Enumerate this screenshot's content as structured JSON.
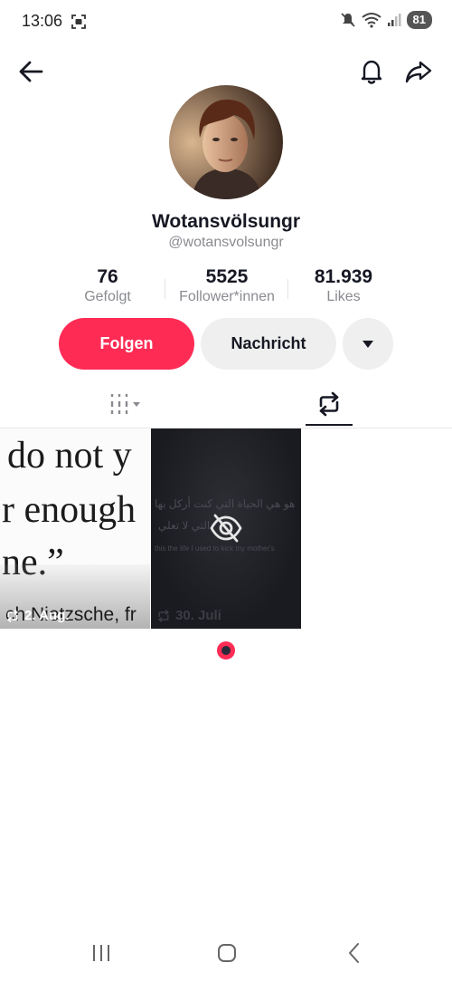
{
  "status_bar": {
    "time": "13:06",
    "battery": "81",
    "icons": [
      "screenshot-icon",
      "mute-icon",
      "wifi-icon",
      "signal-icon",
      "battery-icon"
    ]
  },
  "nav": {
    "icons": [
      "back-arrow-icon",
      "bell-icon",
      "share-icon"
    ]
  },
  "profile": {
    "name": "Wotansvölsungr",
    "handle": "@wotansvolsungr",
    "stats": [
      {
        "value": "76",
        "label": "Gefolgt"
      },
      {
        "value": "5525",
        "label": "Follower*innen"
      },
      {
        "value": "81.939",
        "label": "Likes"
      }
    ]
  },
  "actions": {
    "follow": "Folgen",
    "message": "Nachricht",
    "more_icon": "caret-down-icon"
  },
  "tabs": {
    "items": [
      "videos-grid-icon",
      "repost-icon"
    ],
    "active": "repost-icon"
  },
  "videos": [
    {
      "quote_lines": [
        "do not y",
        "r enough",
        "ne.”"
      ],
      "author_text": "ch Nietzsche, fr",
      "date": "2. Aug."
    },
    {
      "arabic_line_1": "هو هي الحياة التي كنت أركل بها",
      "arabic_line_2": "التي لا تعلي",
      "english_line": "this the life I used to kick my mother's",
      "date": "30. Juli",
      "state_icon": "eye-off-icon"
    }
  ],
  "colors": {
    "accent": "#fe2c55",
    "secondary_button": "#efefef",
    "text_primary": "#161823",
    "text_secondary": "#8a8b91"
  },
  "system_nav": {
    "icons": [
      "recent-apps-icon",
      "home-icon",
      "system-back-icon"
    ]
  }
}
